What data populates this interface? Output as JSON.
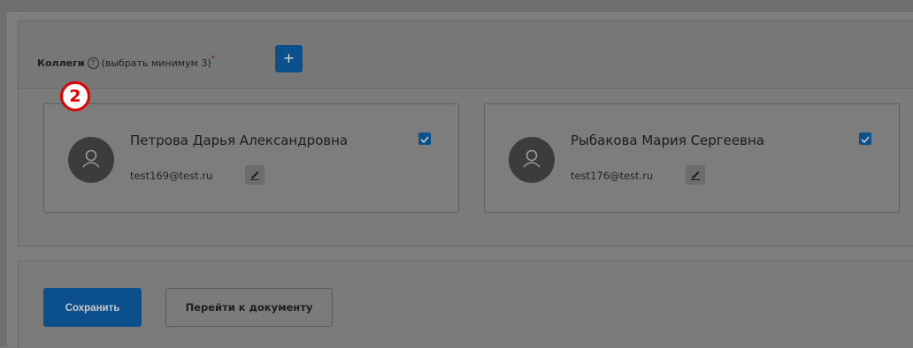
{
  "colleagues": {
    "title": "Коллеги",
    "hint": "(выбрать минимум 3)",
    "required_mark": "*",
    "help_icon": "question-circle-icon",
    "add_label": "+",
    "step_badge": "2",
    "cards": [
      {
        "name": "Петрова Дарья Александровна",
        "email": "test169@test.ru",
        "checked": true,
        "avatar_icon": "user-icon",
        "edit_icon": "pencil-icon"
      },
      {
        "name": "Рыбакова Мария Сергеевна",
        "email": "test176@test.ru",
        "checked": true,
        "avatar_icon": "user-icon",
        "edit_icon": "pencil-icon"
      }
    ]
  },
  "footer": {
    "save_label": "Сохранить",
    "goto_doc_label": "Перейти к документу"
  },
  "colors": {
    "accent": "#0b4f8c",
    "badge": "#e00000",
    "overlay": "#7b7b7b"
  }
}
